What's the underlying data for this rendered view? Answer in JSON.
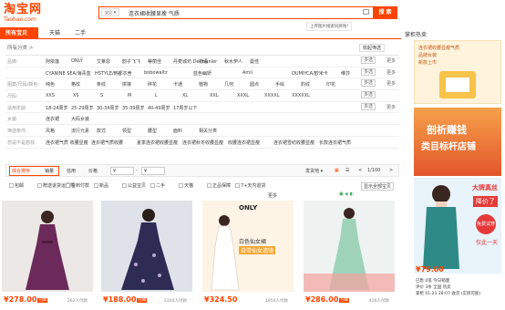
{
  "logo": {
    "cn": "淘宝网",
    "en": "Taobao.com"
  },
  "search": {
    "category": "宝贝",
    "query": "连衣裙收腰显瘦 气质",
    "button": "搜 索",
    "tip": "上传图片搜索同款啦!"
  },
  "tabs": [
    {
      "label": "所有宝贝"
    },
    {
      "label": "天猫"
    },
    {
      "label": "二手"
    }
  ],
  "crumb": {
    "left": "所有分类 >",
    "right": "收起筛选"
  },
  "attrs": [
    {
      "key": "品牌:",
      "values": [
        "阿依莲",
        "ONLY",
        "艾莱恩",
        "韵子飞飞",
        "蒂丽佳",
        "丹麦城坊 Dermunier",
        "初语",
        "秋水伊人",
        "曼佳"
      ],
      "multi": "多选",
      "more": "更多"
    },
    {
      "key": "",
      "values": [
        "CYANINE SEA/海青蓝",
        "HSTYLE/韩都衣舍",
        "bobowaltz",
        "蓝色幽妍",
        "Amii",
        "OUMIYCA/欧米卡",
        "维莎"
      ],
      "multi": "多选",
      "more": "更多"
    },
    {
      "key": "图案/尺码/颜色:",
      "values": [
        "纯色",
        "格纹",
        "条纹",
        "拼接",
        "碎花",
        "卡通",
        "植物",
        "几何",
        "圆点",
        "手绘",
        "豹纹",
        "印花"
      ],
      "multi": "多选",
      "more": "更多"
    },
    {
      "key": "尺码:",
      "values": [
        "XXS",
        "XS",
        "S",
        "M",
        "L",
        "XL",
        "XXL",
        "XXXL",
        "XXXXL",
        "XXXXXL"
      ],
      "multi": "多选",
      "more": ""
    },
    {
      "key": "适用年龄:",
      "values": [
        "18-24周岁",
        "25-29周岁",
        "30-34周岁",
        "35-39周岁",
        "40-49周岁",
        "17周岁以下"
      ],
      "multi": "多选",
      "more": "更多"
    },
    {
      "key": "女装:",
      "values": [
        "连衣裙",
        "大码女装"
      ],
      "multi": "",
      "more": ""
    },
    {
      "key": "筛选条件:",
      "values": [
        "风格",
        "流行元素",
        "款式",
        "领型",
        "腰型",
        "面料",
        "相关分类"
      ],
      "multi": "",
      "more": ""
    },
    {
      "key": "您是不是想找:",
      "values": [
        "连衣裙气质 收腰显瘦",
        "连衣裙气质收腰",
        "夏季连衣裙收腰显瘦",
        "连衣裙秋冬收腰显瘦",
        "收腰连衣裙显瘦",
        "连衣裙雪纺收腰显瘦",
        "长款连衣裙气质"
      ],
      "multi": "",
      "more": ""
    }
  ],
  "sortbar": {
    "items": [
      "综合排序",
      "销量",
      "信用",
      "价格",
      "¥",
      "-",
      "¥"
    ],
    "ship": "发货地",
    "page": "1/100",
    "prev": "<",
    "next": ">"
  },
  "filters": [
    "包邮",
    "赠送退货运费险",
    "货到付款",
    "新品",
    "公益宝贝",
    "二手",
    "天猫",
    "正品保障",
    "7+天内退货"
  ],
  "filter_more": "更多",
  "filter_right": "显示全部宝贝",
  "products": [
    {
      "price": "¥278.00",
      "sales": "262人付款",
      "badge": "包邮"
    },
    {
      "price": "¥188.00",
      "sales": "2204人付款",
      "badge": "包邮"
    },
    {
      "price": "¥324.50",
      "sales": "1950人付款",
      "badge": ""
    },
    {
      "price": "¥286.00",
      "sales": "426人付款",
      "badge": "包邮"
    },
    {
      "price": "",
      "sales": "",
      "badge": ""
    }
  ],
  "product_texts": {
    "only": "ONLY",
    "p3line": "白色仙女裙",
    "p3sub": "自带仙女滤镜"
  },
  "side": {
    "title": "掌柜热卖",
    "ad1a": "连衣裙收腰显瘦气质",
    "ad1b": "品牌女装",
    "ad1c": "新款上市",
    "ad2a": "剖析赚钱",
    "ad2b": "类目标杆店铺",
    "ad3a": "大牌真丝",
    "ad3b": "降价了",
    "ad3c": "免费试穿",
    "ad3d": "仅此一天",
    "price": "¥79.00",
    "info1": "已售 0笔 今日销量",
    "info2": "评价 3条 全国 热卖",
    "info3": "掌柜 01-21 28:07 收货 (实际可能)"
  },
  "colors": {
    "accent": "#ff4400"
  }
}
